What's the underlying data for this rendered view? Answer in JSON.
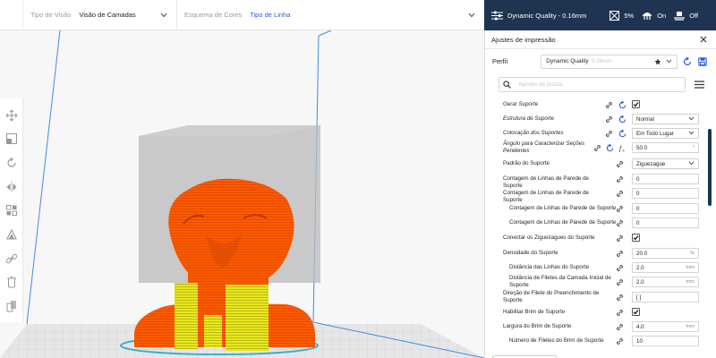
{
  "topbar": {
    "view_type_label": "Tipo de Visão",
    "view_type_value": "Visão de Camadas",
    "color_scheme_label": "Esquema de Cores",
    "color_scheme_value": "Tipo de Linha"
  },
  "header": {
    "profile": "Dynamic Quality - 0.16mm",
    "infill": "5%",
    "support": "On",
    "adhesion": "Off"
  },
  "panel": {
    "title": "Ajustes de impressão",
    "profile_label": "Perfil",
    "profile_name": "Dynamic Quality",
    "profile_sub": "0.16mm",
    "search_placeholder": "Ajustes de busca"
  },
  "settings": [
    {
      "label": "Gerar Suporte",
      "italic": true,
      "reset": true,
      "type": "check",
      "checked": true
    },
    {
      "label": "Estrutura de Suporte",
      "italic": true,
      "reset": true,
      "type": "select",
      "value": "Normal"
    },
    {
      "label": "Colocação dos Suportes",
      "italic": true,
      "reset": true,
      "type": "select",
      "value": "Em Todo Lugar"
    },
    {
      "label": "Ângulo para Caracterizar Seções Pendentes",
      "italic": true,
      "reset": true,
      "fx": true,
      "type": "number",
      "value": "50.0",
      "unit": "°"
    },
    {
      "label": "Padrão do Suporte",
      "type": "select",
      "value": "Ziguezague"
    },
    {
      "label": "Contagem de Linhas de Parede de Suporte",
      "type": "number",
      "value": "0"
    },
    {
      "label": "Contagem de Linhas de Parede de Suporte",
      "type": "number",
      "value": "0"
    },
    {
      "label": "Contagem de Linhas de Parede de Suporte",
      "indent": true,
      "type": "number",
      "value": "0"
    },
    {
      "label": "Contagem de Linhas de Parede de Suporte",
      "indent": true,
      "type": "number",
      "value": "0"
    },
    {
      "label": "Conectar os Ziguezagues do Suporte",
      "type": "check",
      "checked": true
    },
    {
      "label": "Densidade do Suporte",
      "type": "number",
      "value": "20.0",
      "unit": "%"
    },
    {
      "label": "Distância das Linhas do Suporte",
      "indent": true,
      "type": "number",
      "value": "2.0",
      "unit": "mm"
    },
    {
      "label": "Distância de Filetes da Camada Inicial de Suporte",
      "indent": true,
      "type": "number",
      "value": "2.0",
      "unit": "mm"
    },
    {
      "label": "Direção de Filete do Preenchimento de Suporte",
      "type": "text",
      "value": "[ ]"
    },
    {
      "label": "Habilitar Brim de Suporte",
      "type": "check",
      "checked": true
    },
    {
      "label": "Largura do Brim de Suporte",
      "type": "number",
      "value": "4.0",
      "unit": "mm"
    },
    {
      "label": "Número de Filetes do Brim de Suporte",
      "indent": true,
      "type": "number",
      "value": "10"
    }
  ],
  "colors": {
    "header_bg": "#1e3450",
    "accent": "#2b5ed6",
    "model": "#ff5a00",
    "support": "#e8e81a",
    "build_volume": "#3c8ce6"
  }
}
